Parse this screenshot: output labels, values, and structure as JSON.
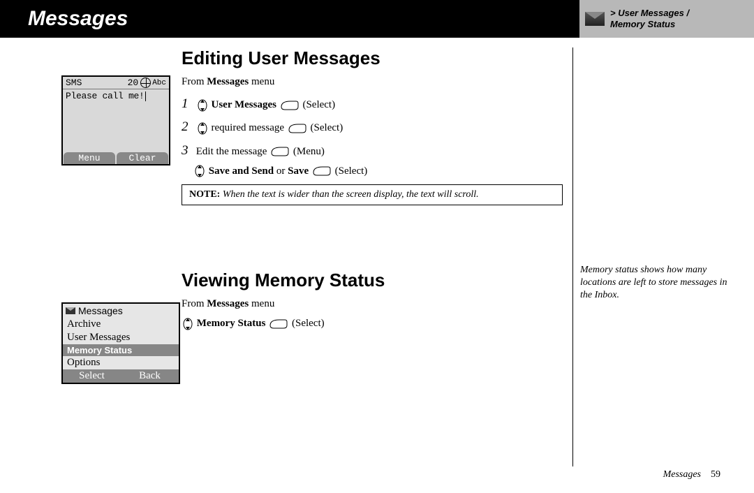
{
  "header": {
    "title": "Messages",
    "breadcrumb_line1": "> User Messages /",
    "breadcrumb_line2": "Memory Status"
  },
  "section1": {
    "heading": "Editing User Messages",
    "from_prefix": "From ",
    "from_bold": "Messages",
    "from_suffix": " menu",
    "step1_bold": "User Messages",
    "step1_rest": " (Select)",
    "step2_text": " required message ",
    "step2_rest": " (Select)",
    "step3_pre": "Edit the message ",
    "step3_rest": " (Menu)",
    "step4_bold": "Save and Send",
    "step4_mid": " or ",
    "step4_bold2": "Save",
    "step4_rest": " (Select)",
    "note_label": "NOTE:",
    "note_text": " When the text is wider than the screen display, the text will scroll."
  },
  "section2": {
    "heading": "Viewing Memory Status",
    "from_prefix": "From ",
    "from_bold": "Messages",
    "from_suffix": " menu",
    "step_bold": "Memory Status",
    "step_rest": " (Select)"
  },
  "sidebar_note": "Memory status shows how many locations are left to store messages in the Inbox.",
  "phone1": {
    "top_left": "SMS",
    "top_right": "20",
    "mode": "Abc",
    "body": "Please call me!",
    "soft_left": "Menu",
    "soft_right": "Clear"
  },
  "phone2": {
    "title": "Messages",
    "items": [
      "Archive",
      "User Messages",
      "Memory Status",
      "Options"
    ],
    "selected_index": 2,
    "soft_left": "Select",
    "soft_right": "Back"
  },
  "footer": {
    "label": "Messages",
    "page": "59"
  }
}
